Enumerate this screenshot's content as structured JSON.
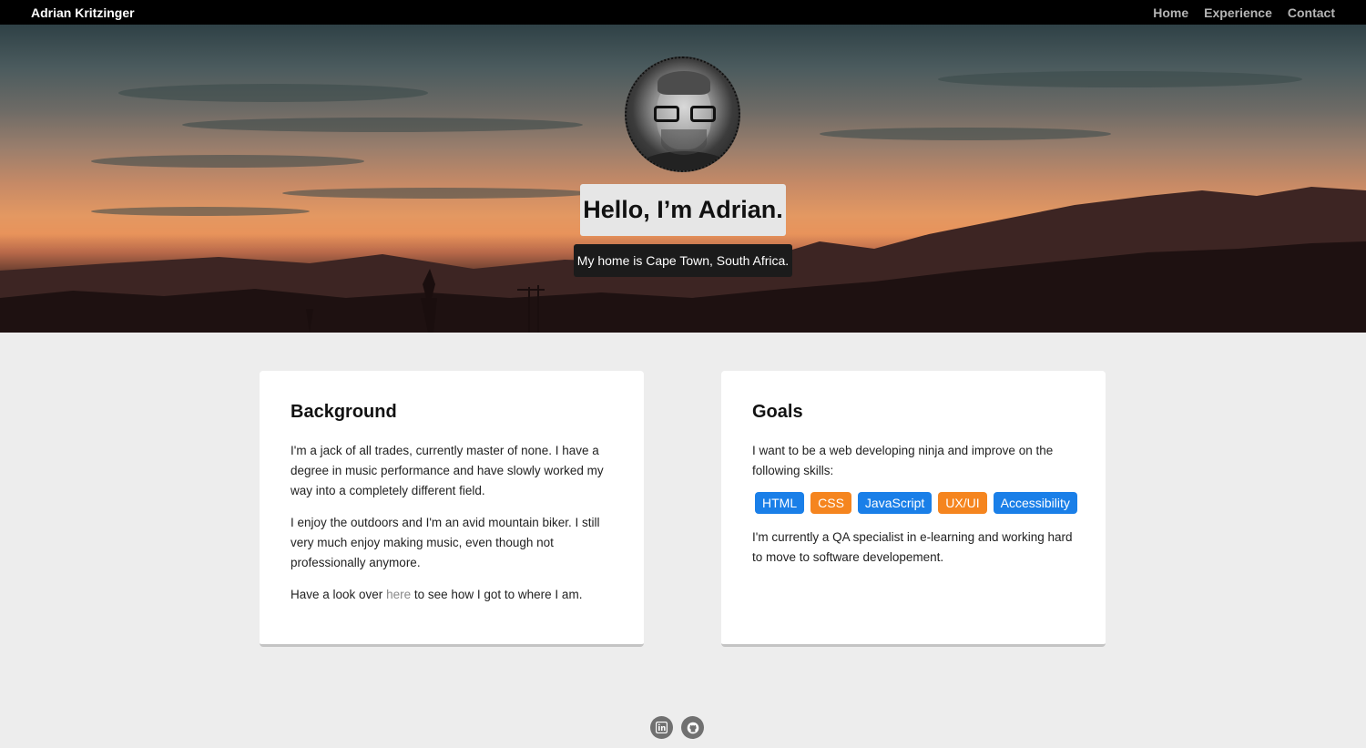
{
  "nav": {
    "brand": "Adrian Kritzinger",
    "links": [
      {
        "label": "Home"
      },
      {
        "label": "Experience"
      },
      {
        "label": "Contact"
      }
    ]
  },
  "hero": {
    "title": "Hello, I’m Adrian.",
    "subtitle": "My home is Cape Town, South Africa."
  },
  "background_card": {
    "heading": "Background",
    "p1": "I'm a jack of all trades, currently master of none. I have a degree in music performance and have slowly worked my way into a completely different field.",
    "p2": "I enjoy the outdoors and I'm an avid mountain biker. I still very much enjoy making music, even though not professionally anymore.",
    "p3_before": "Have a look over ",
    "p3_link": "here",
    "p3_after": " to see how I got to where I am."
  },
  "goals_card": {
    "heading": "Goals",
    "p1": "I want to be a web developing ninja and improve on the following skills:",
    "tags": [
      {
        "label": "HTML",
        "color": "#1a7fe8"
      },
      {
        "label": "CSS",
        "color": "#f5851f"
      },
      {
        "label": "JavaScript",
        "color": "#1a7fe8"
      },
      {
        "label": "UX/UI",
        "color": "#f5851f"
      },
      {
        "label": "Accessibility",
        "color": "#1a7fe8"
      }
    ],
    "p2": "I'm currently a QA specialist in e-learning and working hard to move to software developement."
  },
  "footer": {
    "icons": [
      "linkedin-icon",
      "github-icon"
    ]
  },
  "colors": {
    "nav_bg": "#000000",
    "page_bg": "#ededed",
    "tag_blue": "#1a7fe8",
    "tag_orange": "#f5851f"
  }
}
